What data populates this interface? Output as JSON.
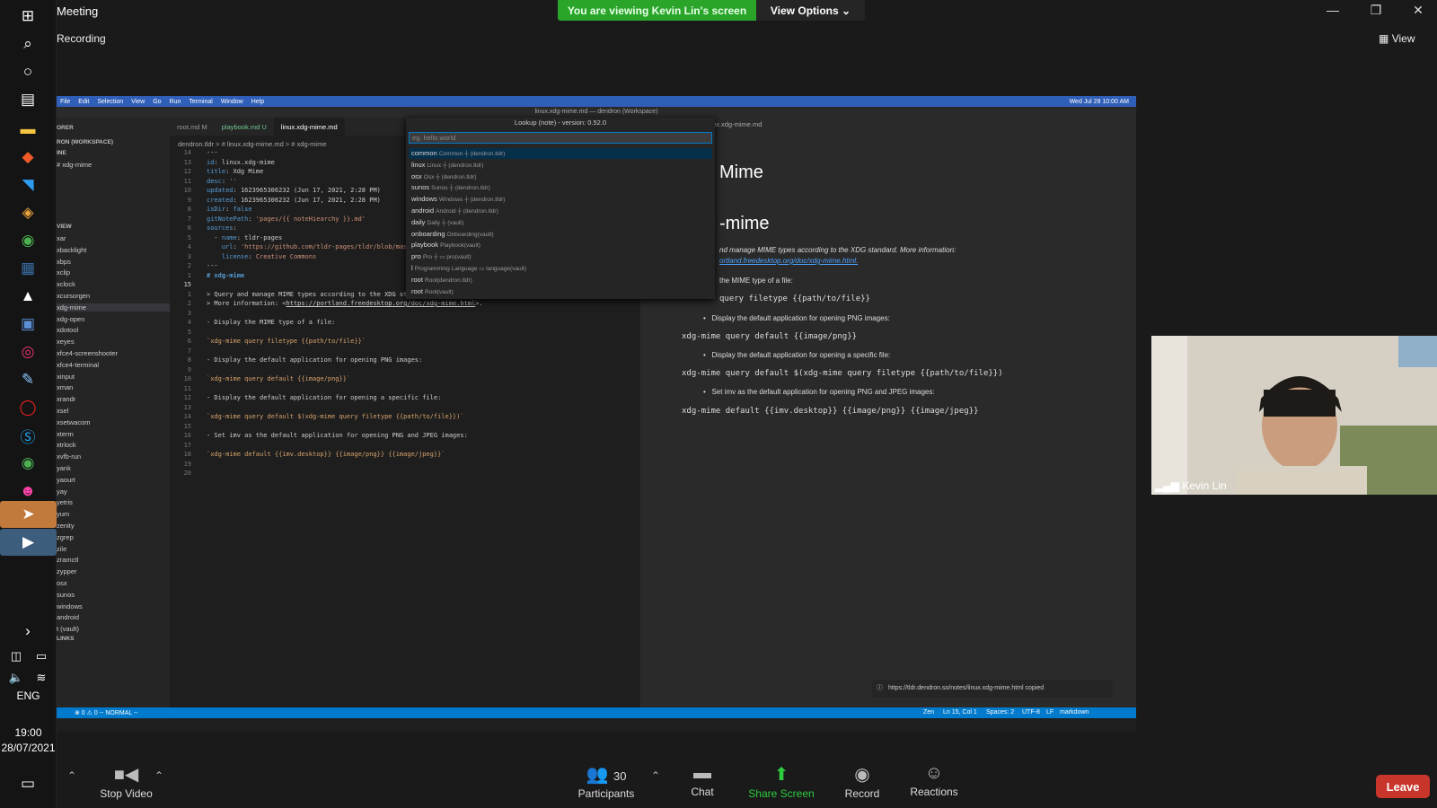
{
  "window": {
    "title": "Meeting",
    "recording": "Recording",
    "banner": "You are viewing Kevin Lin's screen",
    "view_options": "View Options",
    "view": "View"
  },
  "taskbar": {
    "time": "19:00",
    "date": "28/07/2021",
    "lang": "ENG"
  },
  "vscode": {
    "menus": [
      "File",
      "Edit",
      "Selection",
      "View",
      "Go",
      "Run",
      "Terminal",
      "Window",
      "Help"
    ],
    "clock": "Wed Jul 28 10:00 AM",
    "title": "linux.xdg-mime.md — dendron (Workspace)",
    "sidebar": {
      "explorer": "ORER",
      "workspace": "RON (WORKSPACE)",
      "outline": "INE",
      "outline_item": "# xdg-mime",
      "tree_view": "VIEW",
      "tree": [
        "xar",
        "xbacklight",
        "xbps",
        "xclip",
        "xclock",
        "xcursorgen",
        "xdg-mime",
        "xdg-open",
        "xdotool",
        "xeyes",
        "xfce4-screenshooter",
        "xfce4-terminal",
        "xinput",
        "xman",
        "xrandr",
        "xsel",
        "xsetwacom",
        "xterm",
        "xtrlock",
        "xvfb-run",
        "yank",
        "yaourt",
        "yay",
        "yetris",
        "yum",
        "zenity",
        "zgrep",
        "zile",
        "zramctl",
        "zypper",
        "osx",
        "sunos",
        "windows",
        "android",
        "t (vault)"
      ],
      "backlinks": "LINKS"
    },
    "tabs": [
      "root.md M",
      "playbook.md U",
      "linux.xdg-mime.md"
    ],
    "breadcrumb": "dendron.tldr  >  # linux.xdg-mime.md  >  # xdg-mime",
    "lookup": {
      "title": "Lookup (note) - version: 0.52.0",
      "placeholder": "eg. hello.world",
      "items": [
        {
          "name": "common",
          "sub": "Common ┼ (dendron.tldr)"
        },
        {
          "name": "linux",
          "sub": "Linux ┼ (dendron.tldr)"
        },
        {
          "name": "osx",
          "sub": "Osx ┼ (dendron.tldr)"
        },
        {
          "name": "sunos",
          "sub": "Sunos ┼ (dendron.tldr)"
        },
        {
          "name": "windows",
          "sub": "Windows ┼ (dendron.tldr)"
        },
        {
          "name": "android",
          "sub": "Android ┼ (dendron.tldr)"
        },
        {
          "name": "daily",
          "sub": "Daily ┼ (vault)"
        },
        {
          "name": "onboarding",
          "sub": "Onboarding(vault)"
        },
        {
          "name": "playbook",
          "sub": "Playbook(vault)"
        },
        {
          "name": "pro",
          "sub": "Pro ┼ ▭ pro(vault)"
        },
        {
          "name": "l",
          "sub": "Programming Language ▭ language(vault)"
        },
        {
          "name": "root",
          "sub": "Root(dendron.tldr)"
        },
        {
          "name": "root",
          "sub": "Root(vault)"
        }
      ]
    },
    "preview_tab": "ux.xdg-mime.md",
    "preview": {
      "h1": "Mime",
      "h2": "-mime",
      "desc1": "nd manage MIME types according to the XDG standard. More information:",
      "desc2": "ortland.freedesktop.org/doc/xdg-mime.html.",
      "b1": "the MIME type of a file:",
      "c1": "query filetype {{path/to/file}}",
      "b2": "Display the default application for opening PNG images:",
      "c2": "xdg-mime query default {{image/png}}",
      "b3": "Display the default application for opening a specific file:",
      "c3": "xdg-mime query default $(xdg-mime query filetype {{path/to/file}})",
      "b4": "Set imv as the default application for opening PNG and JPEG images:",
      "c4": "xdg-mime default {{imv.desktop}} {{image/png}} {{image/jpeg}}"
    },
    "toast": "https://tldr.dendron.so/notes/linux.xdg-mime.html copied",
    "status_left": "⊗ 0 ⚠ 0     -- NORMAL --",
    "status_right": [
      "Zen",
      "Ln 15, Col 1",
      "Spaces: 2",
      "UTF-8",
      "LF",
      "markdown"
    ]
  },
  "webcam": {
    "name": "Kevin Lin"
  },
  "bottom": {
    "stop_video": "Stop Video",
    "participants": "Participants",
    "participants_count": "30",
    "chat": "Chat",
    "share": "Share Screen",
    "record": "Record",
    "reactions": "Reactions",
    "leave": "Leave"
  }
}
